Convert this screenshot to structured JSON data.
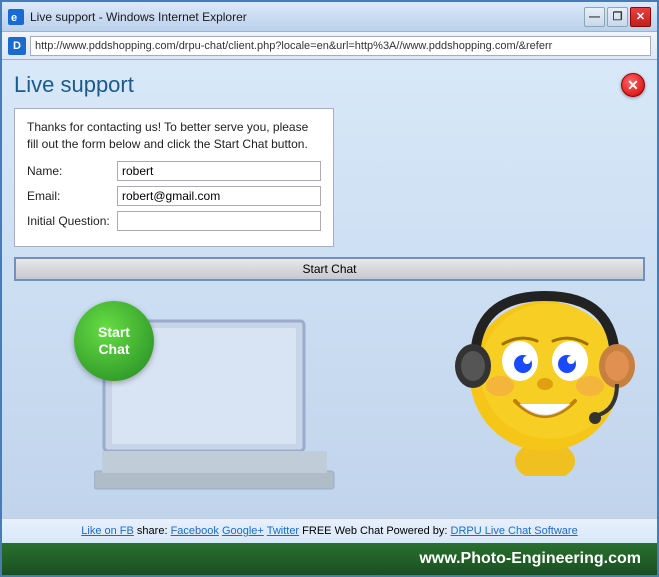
{
  "window": {
    "title": "Live support - Windows Internet Explorer",
    "title_icon": "IE",
    "address": "http://www.pddshopping.com/drpu-chat/client.php?locale=en&url=http%3A//www.pddshopping.com/&referr",
    "controls": {
      "minimize": "—",
      "restore": "❐",
      "close": "✕"
    }
  },
  "header": {
    "title": "Live support",
    "close_label": "✕"
  },
  "form": {
    "intro": "Thanks for contacting us! To better serve you, please fill out the form below and click the Start Chat button.",
    "name_label": "Name:",
    "name_value": "robert",
    "email_label": "Email:",
    "email_value": "robert@gmail.com",
    "question_label": "Initial Question:",
    "question_value": "",
    "start_chat_label": "Start Chat"
  },
  "circle": {
    "text": "Start\nChat"
  },
  "footer": {
    "like_fb": "Like on FB",
    "share_label": "share:",
    "facebook": "Facebook",
    "googleplus": "Google+",
    "twitter": "Twitter",
    "free_label": "FREE Web Chat Powered by:",
    "drpu_label": "DRPU Live Chat Software"
  },
  "brand": {
    "text": "www.Photo-Engineering.com"
  }
}
